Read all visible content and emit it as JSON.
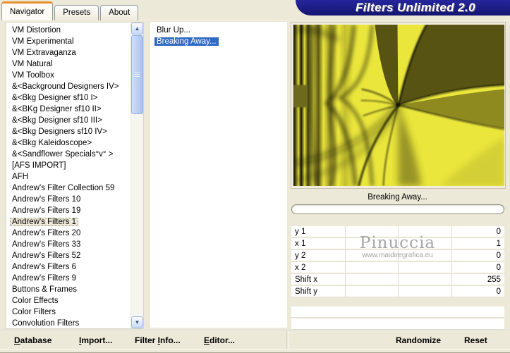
{
  "window": {
    "title": "Filters Unlimited 2.0"
  },
  "tabs": [
    {
      "label": "Navigator",
      "selected": true
    },
    {
      "label": "Presets"
    },
    {
      "label": "About"
    }
  ],
  "navigator": {
    "categories": [
      "VM Distortion",
      "VM Experimental",
      "VM Extravaganza",
      "VM Natural",
      "VM Toolbox",
      "&<Background Designers IV>",
      "&<Bkg Designer sf10 I>",
      "&<BKg Designer sf10 II>",
      "&<Bkg Designer sf10 III>",
      "&<Bkg Designers sf10 IV>",
      "&<Bkg Kaleidoscope>",
      "&<Sandflower Specials°v° >",
      "[AFS IMPORT]",
      "AFH",
      "Andrew's Filter Collection 59",
      "Andrew's Filters 10",
      "Andrew's Filters 19",
      {
        "label": "Andrew's Filters 1",
        "selected": true
      },
      "Andrew's Filters 20",
      "Andrew's Filters 33",
      "Andrew's Filters 52",
      "Andrew's Filters 6",
      "Andrew's Filters 9",
      "Buttons & Frames",
      "Color Effects",
      "Color Filters",
      "Convolution Filters"
    ],
    "filters": [
      {
        "label": "Blur Up..."
      },
      {
        "label": "Breaking Away...",
        "selected": true
      }
    ]
  },
  "preview": {
    "caption": "Breaking Away...",
    "progress_value": 0
  },
  "parameters": [
    {
      "label": "y 1",
      "value": "0"
    },
    {
      "label": "x 1",
      "value": "1"
    },
    {
      "label": "y 2",
      "value": "0"
    },
    {
      "label": "x 2",
      "value": "0"
    },
    {
      "label": "Shift x",
      "value": "255"
    },
    {
      "label": "Shift y",
      "value": "0"
    }
  ],
  "watermark": {
    "name": "Pinuccia",
    "url": "www.maidiregrafica.eu"
  },
  "toolbar": {
    "database": {
      "pre": "",
      "key": "D",
      "post": "atabase"
    },
    "import": {
      "pre": "",
      "key": "I",
      "post": "mport..."
    },
    "filter_info": {
      "pre": "Filter ",
      "key": "I",
      "post": "nfo..."
    },
    "editor": {
      "pre": "",
      "key": "E",
      "post": "ditor..."
    },
    "randomize": "Randomize",
    "reset": "Reset"
  },
  "colors": {
    "dialog_bg": "#ece9d8",
    "selection_blue": "#316ac5",
    "banner_navy": "#1b1b85",
    "tab_accent_orange": "#e5902e",
    "preview_yellow": "#eae63c",
    "preview_olive": "#575313"
  }
}
